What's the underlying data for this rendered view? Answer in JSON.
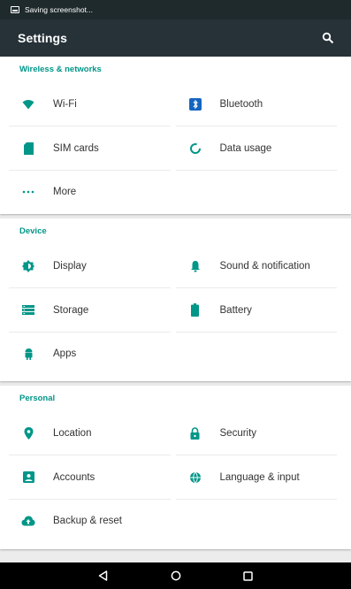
{
  "status_bar": {
    "notification_text": "Saving screenshot..."
  },
  "app_bar": {
    "title": "Settings",
    "search_icon": "search-icon"
  },
  "colors": {
    "accent": "#009688",
    "app_bar": "#263238",
    "status_bar": "#1f2a2c",
    "bluetooth_blue": "#1565c0"
  },
  "sections": [
    {
      "header": "Wireless & networks",
      "items": [
        {
          "label": "Wi-Fi",
          "icon": "wifi-icon"
        },
        {
          "label": "Bluetooth",
          "icon": "bluetooth-icon"
        },
        {
          "label": "SIM cards",
          "icon": "sim-card-icon"
        },
        {
          "label": "Data usage",
          "icon": "data-usage-icon"
        },
        {
          "label": "More",
          "icon": "more-icon"
        }
      ]
    },
    {
      "header": "Device",
      "items": [
        {
          "label": "Display",
          "icon": "display-icon"
        },
        {
          "label": "Sound & notification",
          "icon": "bell-icon"
        },
        {
          "label": "Storage",
          "icon": "storage-icon"
        },
        {
          "label": "Battery",
          "icon": "battery-icon"
        },
        {
          "label": "Apps",
          "icon": "android-icon"
        }
      ]
    },
    {
      "header": "Personal",
      "items": [
        {
          "label": "Location",
          "icon": "location-pin-icon"
        },
        {
          "label": "Security",
          "icon": "lock-icon"
        },
        {
          "label": "Accounts",
          "icon": "account-icon"
        },
        {
          "label": "Language & input",
          "icon": "globe-icon"
        },
        {
          "label": "Backup & reset",
          "icon": "cloud-upload-icon"
        }
      ]
    }
  ],
  "nav_bar": {
    "buttons": [
      "back-icon",
      "home-icon",
      "recents-icon"
    ]
  }
}
